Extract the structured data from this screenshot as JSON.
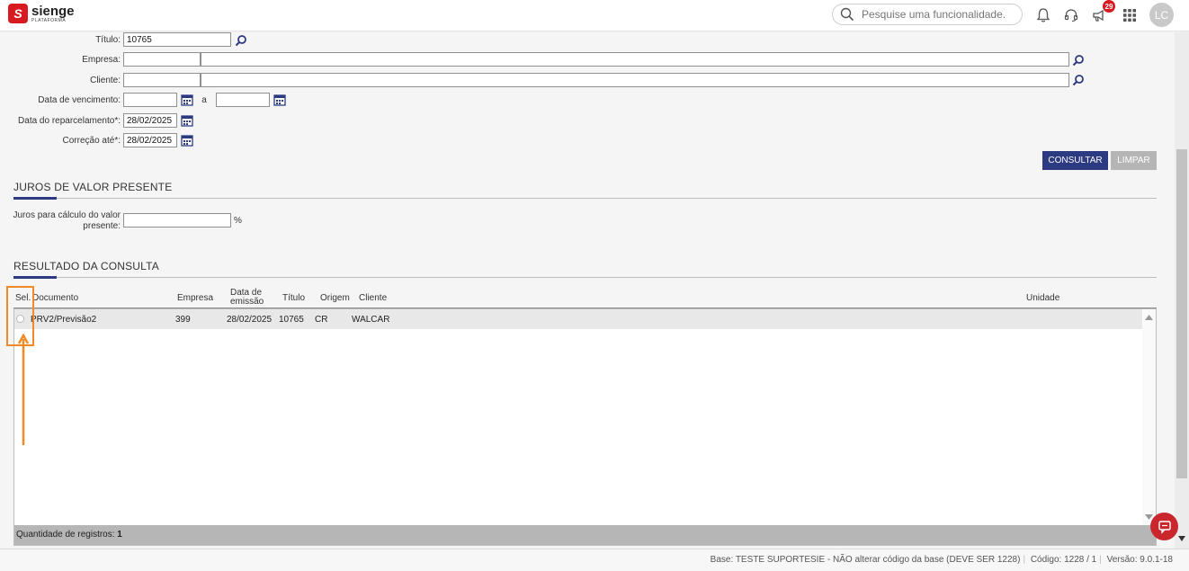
{
  "brand": {
    "name": "sienge",
    "sub": "PLATAFORMA"
  },
  "topbar": {
    "search_placeholder": "Pesquise uma funcionalidade.",
    "notification_count": "29",
    "avatar_initials": "LC"
  },
  "form": {
    "titulo_label": "Título:",
    "titulo_value": "10765",
    "empresa_label": "Empresa:",
    "empresa_code": "",
    "empresa_name": "",
    "cliente_label": "Cliente:",
    "cliente_code": "",
    "cliente_name": "",
    "vencimento_label": "Data de vencimento:",
    "vencimento_from": "",
    "vencimento_sep": "a",
    "vencimento_to": "",
    "reparcelamento_label": "Data do reparcelamento*:",
    "reparcelamento_value": "28/02/2025",
    "correcao_label": "Correção até*:",
    "correcao_value": "28/02/2025",
    "consultar_label": "CONSULTAR",
    "limpar_label": "LIMPAR"
  },
  "juros": {
    "title": "JUROS DE VALOR PRESENTE",
    "label_line1": "Juros para cálculo do valor",
    "label_line2": "presente:",
    "value": "",
    "unit": "%"
  },
  "result": {
    "title": "RESULTADO DA CONSULTA",
    "headers": {
      "sel": "Sel.",
      "documento": "Documento",
      "empresa": "Empresa",
      "data_line1": "Data de",
      "data_line2": "emissão",
      "titulo": "Título",
      "origem": "Origem",
      "cliente": "Cliente",
      "unidade": "Unidade"
    },
    "rows": [
      {
        "documento": "PRV2/Previsão2",
        "empresa": "399",
        "data": "28/02/2025",
        "titulo": "10765",
        "origem": "CR",
        "cliente": "WALCAR",
        "unidade": ""
      }
    ],
    "count_label": "Quantidade de registros:",
    "count_value": "1"
  },
  "status": {
    "base": "Base: TESTE SUPORTESIE - NÃO alterar código da base (DEVE SER 1228)",
    "codigo": "Código: 1228 / 1",
    "versao": "Versão: 9.0.1-18"
  },
  "colors": {
    "primary": "#2c3a82",
    "disabled": "#b5b5b5",
    "brand": "#d71920",
    "annotation": "#f08a24"
  }
}
